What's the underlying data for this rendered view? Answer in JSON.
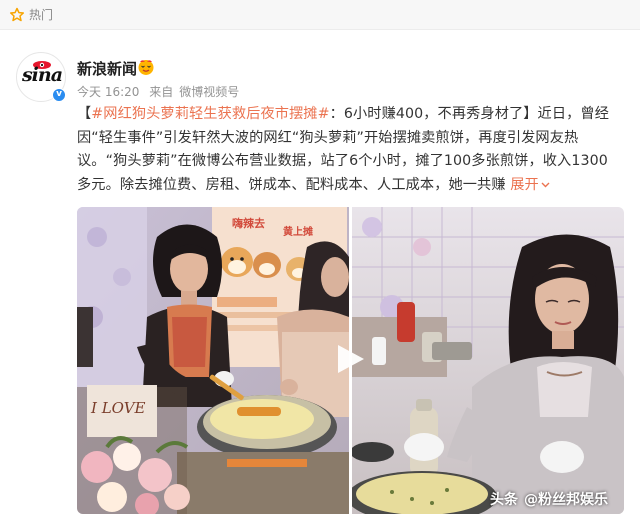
{
  "topbar": {
    "label": "热门",
    "icon": "hot-star-icon"
  },
  "post": {
    "author": {
      "name": "新浪新闻",
      "avatar_logo_text": "sina",
      "badge_icon": "verified-badge-icon",
      "vip_icon": "vip-emoji-icon"
    },
    "meta": {
      "time": "今天 16:20",
      "source_prefix": "来自",
      "source": "微博视频号"
    },
    "text": {
      "bracket_open": "【",
      "topic": "#网红狗头萝莉轻生获救后夜市摆摊#",
      "body": "：6小时赚400，不再秀身材了】近日，曾经因“轻生事件”引发轩然大波的网红“狗头萝莉”开始摆摊卖煎饼，再度引发网友热议。“狗头萝莉”在微博公布营业数据，站了6个小时，摊了100多张煎饼，收入1300多元。除去摊位费、房租、饼成本、配料成本、人工成本，她一共赚",
      "expand": "展开"
    },
    "media": {
      "play_icon": "play-icon",
      "left_sign": "嗨辣去",
      "left_sign2": "黄上摊",
      "left_card": "I LOVE",
      "watermark_brand": "头条",
      "watermark_account": "@粉丝邦娱乐"
    }
  },
  "colors": {
    "accent": "#eb7350",
    "verified": "#2a8cf0",
    "meta": "#939393"
  }
}
